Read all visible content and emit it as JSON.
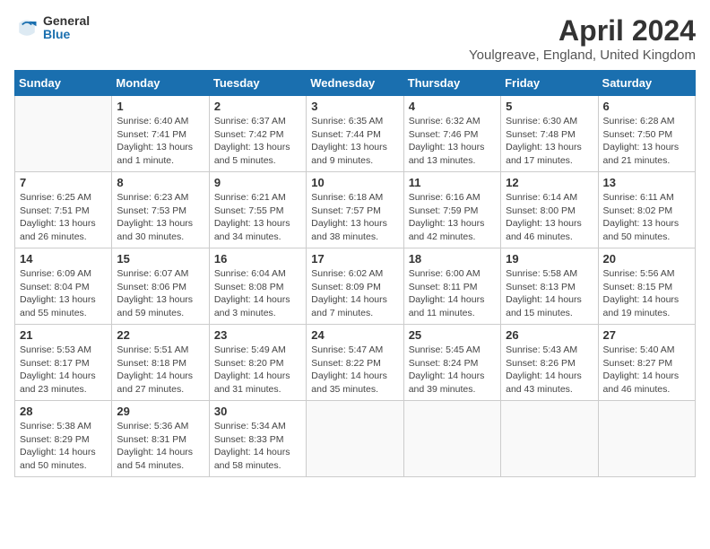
{
  "logo": {
    "line1": "General",
    "line2": "Blue"
  },
  "title": "April 2024",
  "location": "Youlgreave, England, United Kingdom",
  "days_of_week": [
    "Sunday",
    "Monday",
    "Tuesday",
    "Wednesday",
    "Thursday",
    "Friday",
    "Saturday"
  ],
  "weeks": [
    [
      {
        "day": "",
        "info": ""
      },
      {
        "day": "1",
        "info": "Sunrise: 6:40 AM\nSunset: 7:41 PM\nDaylight: 13 hours\nand 1 minute."
      },
      {
        "day": "2",
        "info": "Sunrise: 6:37 AM\nSunset: 7:42 PM\nDaylight: 13 hours\nand 5 minutes."
      },
      {
        "day": "3",
        "info": "Sunrise: 6:35 AM\nSunset: 7:44 PM\nDaylight: 13 hours\nand 9 minutes."
      },
      {
        "day": "4",
        "info": "Sunrise: 6:32 AM\nSunset: 7:46 PM\nDaylight: 13 hours\nand 13 minutes."
      },
      {
        "day": "5",
        "info": "Sunrise: 6:30 AM\nSunset: 7:48 PM\nDaylight: 13 hours\nand 17 minutes."
      },
      {
        "day": "6",
        "info": "Sunrise: 6:28 AM\nSunset: 7:50 PM\nDaylight: 13 hours\nand 21 minutes."
      }
    ],
    [
      {
        "day": "7",
        "info": "Sunrise: 6:25 AM\nSunset: 7:51 PM\nDaylight: 13 hours\nand 26 minutes."
      },
      {
        "day": "8",
        "info": "Sunrise: 6:23 AM\nSunset: 7:53 PM\nDaylight: 13 hours\nand 30 minutes."
      },
      {
        "day": "9",
        "info": "Sunrise: 6:21 AM\nSunset: 7:55 PM\nDaylight: 13 hours\nand 34 minutes."
      },
      {
        "day": "10",
        "info": "Sunrise: 6:18 AM\nSunset: 7:57 PM\nDaylight: 13 hours\nand 38 minutes."
      },
      {
        "day": "11",
        "info": "Sunrise: 6:16 AM\nSunset: 7:59 PM\nDaylight: 13 hours\nand 42 minutes."
      },
      {
        "day": "12",
        "info": "Sunrise: 6:14 AM\nSunset: 8:00 PM\nDaylight: 13 hours\nand 46 minutes."
      },
      {
        "day": "13",
        "info": "Sunrise: 6:11 AM\nSunset: 8:02 PM\nDaylight: 13 hours\nand 50 minutes."
      }
    ],
    [
      {
        "day": "14",
        "info": "Sunrise: 6:09 AM\nSunset: 8:04 PM\nDaylight: 13 hours\nand 55 minutes."
      },
      {
        "day": "15",
        "info": "Sunrise: 6:07 AM\nSunset: 8:06 PM\nDaylight: 13 hours\nand 59 minutes."
      },
      {
        "day": "16",
        "info": "Sunrise: 6:04 AM\nSunset: 8:08 PM\nDaylight: 14 hours\nand 3 minutes."
      },
      {
        "day": "17",
        "info": "Sunrise: 6:02 AM\nSunset: 8:09 PM\nDaylight: 14 hours\nand 7 minutes."
      },
      {
        "day": "18",
        "info": "Sunrise: 6:00 AM\nSunset: 8:11 PM\nDaylight: 14 hours\nand 11 minutes."
      },
      {
        "day": "19",
        "info": "Sunrise: 5:58 AM\nSunset: 8:13 PM\nDaylight: 14 hours\nand 15 minutes."
      },
      {
        "day": "20",
        "info": "Sunrise: 5:56 AM\nSunset: 8:15 PM\nDaylight: 14 hours\nand 19 minutes."
      }
    ],
    [
      {
        "day": "21",
        "info": "Sunrise: 5:53 AM\nSunset: 8:17 PM\nDaylight: 14 hours\nand 23 minutes."
      },
      {
        "day": "22",
        "info": "Sunrise: 5:51 AM\nSunset: 8:18 PM\nDaylight: 14 hours\nand 27 minutes."
      },
      {
        "day": "23",
        "info": "Sunrise: 5:49 AM\nSunset: 8:20 PM\nDaylight: 14 hours\nand 31 minutes."
      },
      {
        "day": "24",
        "info": "Sunrise: 5:47 AM\nSunset: 8:22 PM\nDaylight: 14 hours\nand 35 minutes."
      },
      {
        "day": "25",
        "info": "Sunrise: 5:45 AM\nSunset: 8:24 PM\nDaylight: 14 hours\nand 39 minutes."
      },
      {
        "day": "26",
        "info": "Sunrise: 5:43 AM\nSunset: 8:26 PM\nDaylight: 14 hours\nand 43 minutes."
      },
      {
        "day": "27",
        "info": "Sunrise: 5:40 AM\nSunset: 8:27 PM\nDaylight: 14 hours\nand 46 minutes."
      }
    ],
    [
      {
        "day": "28",
        "info": "Sunrise: 5:38 AM\nSunset: 8:29 PM\nDaylight: 14 hours\nand 50 minutes."
      },
      {
        "day": "29",
        "info": "Sunrise: 5:36 AM\nSunset: 8:31 PM\nDaylight: 14 hours\nand 54 minutes."
      },
      {
        "day": "30",
        "info": "Sunrise: 5:34 AM\nSunset: 8:33 PM\nDaylight: 14 hours\nand 58 minutes."
      },
      {
        "day": "",
        "info": ""
      },
      {
        "day": "",
        "info": ""
      },
      {
        "day": "",
        "info": ""
      },
      {
        "day": "",
        "info": ""
      }
    ]
  ]
}
